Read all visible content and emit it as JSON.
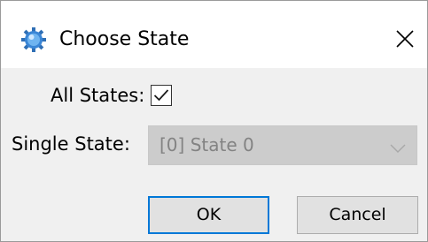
{
  "window": {
    "title": "Choose State",
    "icon": "gear-icon",
    "close_icon": "close-icon"
  },
  "form": {
    "all_states_label": "All States:",
    "all_states_checked": true,
    "single_state_label": "Single State:",
    "single_state_value": "[0] State 0",
    "single_state_enabled": false
  },
  "buttons": {
    "ok_label": "OK",
    "cancel_label": "Cancel"
  },
  "colors": {
    "accent": "#0078d7",
    "dialog_bg": "#f0f0f0",
    "disabled_field_bg": "#cccccc",
    "disabled_text": "#838383"
  }
}
